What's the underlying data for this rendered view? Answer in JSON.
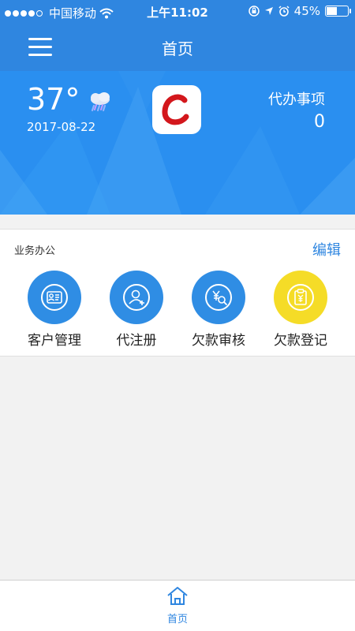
{
  "status_bar": {
    "carrier": "中国移动",
    "time": "上午11:02",
    "battery": "45%",
    "battery_level": 0.45,
    "signal_bars": 4,
    "icons": [
      "wifi-icon",
      "lock-rotation-icon",
      "location-arrow-icon",
      "alarm-icon"
    ]
  },
  "nav": {
    "title": "首页",
    "menu_icon": "hamburger-menu-icon"
  },
  "banner": {
    "temperature": "37°",
    "date": "2017-08-22",
    "weather_icon": "rain-cloud-icon",
    "logo_letter": "C",
    "todo_label": "代办事项",
    "todo_count": "0"
  },
  "office": {
    "title": "业务办公",
    "edit_label": "编辑",
    "items": [
      {
        "label": "客户管理",
        "icon": "customer-card-icon",
        "color": "#2f8de4"
      },
      {
        "label": "代注册",
        "icon": "user-add-icon",
        "color": "#2f8de4"
      },
      {
        "label": "欠款审核",
        "icon": "yen-search-icon",
        "color": "#2f8de4"
      },
      {
        "label": "欠款登记",
        "icon": "clipboard-yen-icon",
        "color": "#f5dc27"
      }
    ]
  },
  "tab_bar": {
    "home_label": "首页",
    "home_icon": "home-icon"
  },
  "colors": {
    "primary": "#2f86e0",
    "banner": "#2a8ff0",
    "accent_yellow": "#f5dc27",
    "logo_red": "#d3171c"
  }
}
